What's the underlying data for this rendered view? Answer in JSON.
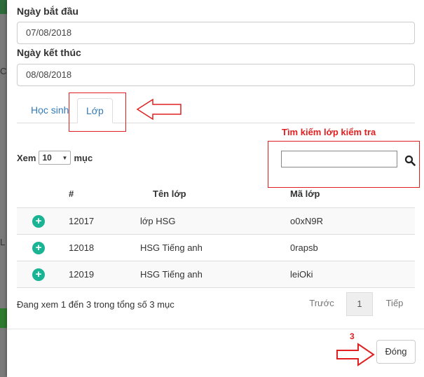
{
  "backdrop": {
    "glyph_1": "C",
    "glyph_2": "L"
  },
  "filters": {
    "start_label": "Ngày bắt đầu",
    "start_value": "07/08/2018",
    "end_label": "Ngày kết thúc",
    "end_value": "08/08/2018"
  },
  "tabs": [
    {
      "label": "Học sinh",
      "active": false
    },
    {
      "label": "Lớp",
      "active": true
    }
  ],
  "annotations": {
    "search_hint": "Tìm kiếm lớp kiểm tra",
    "step_number": "3"
  },
  "length_menu": {
    "prefix": "Xem",
    "value": "10",
    "suffix": "mục"
  },
  "search": {
    "value": ""
  },
  "table": {
    "headers": [
      "#",
      "Tên lớp",
      "Mã lớp"
    ],
    "rows": [
      {
        "id": "12017",
        "name": "lớp HSG",
        "code": "o0xN9R"
      },
      {
        "id": "12018",
        "name": "HSG Tiếng anh",
        "code": "0rapsb"
      },
      {
        "id": "12019",
        "name": "HSG Tiếng anh",
        "code": "leiOki"
      }
    ]
  },
  "info": "Đang xem 1 đến 3 trong tổng số 3 mục",
  "pagination": {
    "prev": "Trước",
    "current": "1",
    "next": "Tiếp"
  },
  "footer": {
    "close_label": "Đóng"
  },
  "colors": {
    "accent": "#337ab7",
    "annotation": "#e02020",
    "add_button": "#1ab394"
  }
}
